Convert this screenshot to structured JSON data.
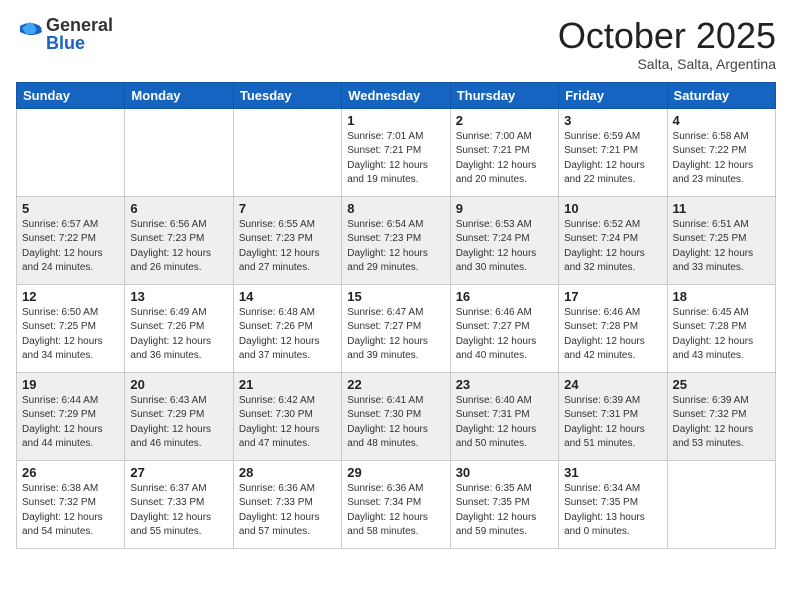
{
  "header": {
    "logo_general": "General",
    "logo_blue": "Blue",
    "month_title": "October 2025",
    "subtitle": "Salta, Salta, Argentina"
  },
  "days_of_week": [
    "Sunday",
    "Monday",
    "Tuesday",
    "Wednesday",
    "Thursday",
    "Friday",
    "Saturday"
  ],
  "weeks": [
    [
      {
        "day": "",
        "info": ""
      },
      {
        "day": "",
        "info": ""
      },
      {
        "day": "",
        "info": ""
      },
      {
        "day": "1",
        "info": "Sunrise: 7:01 AM\nSunset: 7:21 PM\nDaylight: 12 hours\nand 19 minutes."
      },
      {
        "day": "2",
        "info": "Sunrise: 7:00 AM\nSunset: 7:21 PM\nDaylight: 12 hours\nand 20 minutes."
      },
      {
        "day": "3",
        "info": "Sunrise: 6:59 AM\nSunset: 7:21 PM\nDaylight: 12 hours\nand 22 minutes."
      },
      {
        "day": "4",
        "info": "Sunrise: 6:58 AM\nSunset: 7:22 PM\nDaylight: 12 hours\nand 23 minutes."
      }
    ],
    [
      {
        "day": "5",
        "info": "Sunrise: 6:57 AM\nSunset: 7:22 PM\nDaylight: 12 hours\nand 24 minutes."
      },
      {
        "day": "6",
        "info": "Sunrise: 6:56 AM\nSunset: 7:23 PM\nDaylight: 12 hours\nand 26 minutes."
      },
      {
        "day": "7",
        "info": "Sunrise: 6:55 AM\nSunset: 7:23 PM\nDaylight: 12 hours\nand 27 minutes."
      },
      {
        "day": "8",
        "info": "Sunrise: 6:54 AM\nSunset: 7:23 PM\nDaylight: 12 hours\nand 29 minutes."
      },
      {
        "day": "9",
        "info": "Sunrise: 6:53 AM\nSunset: 7:24 PM\nDaylight: 12 hours\nand 30 minutes."
      },
      {
        "day": "10",
        "info": "Sunrise: 6:52 AM\nSunset: 7:24 PM\nDaylight: 12 hours\nand 32 minutes."
      },
      {
        "day": "11",
        "info": "Sunrise: 6:51 AM\nSunset: 7:25 PM\nDaylight: 12 hours\nand 33 minutes."
      }
    ],
    [
      {
        "day": "12",
        "info": "Sunrise: 6:50 AM\nSunset: 7:25 PM\nDaylight: 12 hours\nand 34 minutes."
      },
      {
        "day": "13",
        "info": "Sunrise: 6:49 AM\nSunset: 7:26 PM\nDaylight: 12 hours\nand 36 minutes."
      },
      {
        "day": "14",
        "info": "Sunrise: 6:48 AM\nSunset: 7:26 PM\nDaylight: 12 hours\nand 37 minutes."
      },
      {
        "day": "15",
        "info": "Sunrise: 6:47 AM\nSunset: 7:27 PM\nDaylight: 12 hours\nand 39 minutes."
      },
      {
        "day": "16",
        "info": "Sunrise: 6:46 AM\nSunset: 7:27 PM\nDaylight: 12 hours\nand 40 minutes."
      },
      {
        "day": "17",
        "info": "Sunrise: 6:46 AM\nSunset: 7:28 PM\nDaylight: 12 hours\nand 42 minutes."
      },
      {
        "day": "18",
        "info": "Sunrise: 6:45 AM\nSunset: 7:28 PM\nDaylight: 12 hours\nand 43 minutes."
      }
    ],
    [
      {
        "day": "19",
        "info": "Sunrise: 6:44 AM\nSunset: 7:29 PM\nDaylight: 12 hours\nand 44 minutes."
      },
      {
        "day": "20",
        "info": "Sunrise: 6:43 AM\nSunset: 7:29 PM\nDaylight: 12 hours\nand 46 minutes."
      },
      {
        "day": "21",
        "info": "Sunrise: 6:42 AM\nSunset: 7:30 PM\nDaylight: 12 hours\nand 47 minutes."
      },
      {
        "day": "22",
        "info": "Sunrise: 6:41 AM\nSunset: 7:30 PM\nDaylight: 12 hours\nand 48 minutes."
      },
      {
        "day": "23",
        "info": "Sunrise: 6:40 AM\nSunset: 7:31 PM\nDaylight: 12 hours\nand 50 minutes."
      },
      {
        "day": "24",
        "info": "Sunrise: 6:39 AM\nSunset: 7:31 PM\nDaylight: 12 hours\nand 51 minutes."
      },
      {
        "day": "25",
        "info": "Sunrise: 6:39 AM\nSunset: 7:32 PM\nDaylight: 12 hours\nand 53 minutes."
      }
    ],
    [
      {
        "day": "26",
        "info": "Sunrise: 6:38 AM\nSunset: 7:32 PM\nDaylight: 12 hours\nand 54 minutes."
      },
      {
        "day": "27",
        "info": "Sunrise: 6:37 AM\nSunset: 7:33 PM\nDaylight: 12 hours\nand 55 minutes."
      },
      {
        "day": "28",
        "info": "Sunrise: 6:36 AM\nSunset: 7:33 PM\nDaylight: 12 hours\nand 57 minutes."
      },
      {
        "day": "29",
        "info": "Sunrise: 6:36 AM\nSunset: 7:34 PM\nDaylight: 12 hours\nand 58 minutes."
      },
      {
        "day": "30",
        "info": "Sunrise: 6:35 AM\nSunset: 7:35 PM\nDaylight: 12 hours\nand 59 minutes."
      },
      {
        "day": "31",
        "info": "Sunrise: 6:34 AM\nSunset: 7:35 PM\nDaylight: 13 hours\nand 0 minutes."
      },
      {
        "day": "",
        "info": ""
      }
    ]
  ]
}
